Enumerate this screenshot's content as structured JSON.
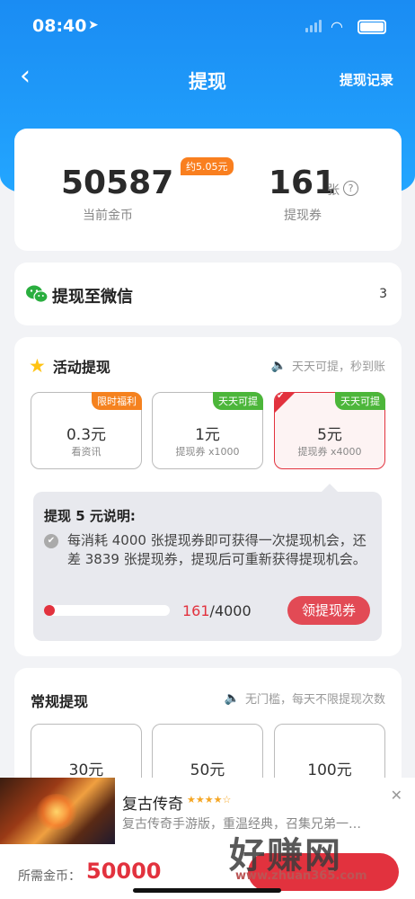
{
  "status": {
    "time": "08:40"
  },
  "nav": {
    "back": "‹",
    "title": "提现",
    "record": "提现记录"
  },
  "balance": {
    "coins": "50587",
    "approx_badge": "约5.05元",
    "coins_label": "当前金币",
    "tickets": "161",
    "tickets_unit": "张",
    "tickets_label": "提现券"
  },
  "wechat": {
    "title": "提现至微信",
    "count": "3"
  },
  "activity": {
    "title": "活动提现",
    "note": "天天可提，秒到账",
    "options": [
      {
        "tag": "限时福利",
        "tag_color": "#f5821f",
        "amount": "0.3元",
        "sub": "看资讯",
        "selected": false
      },
      {
        "tag": "天天可提",
        "tag_color": "#4cb63a",
        "amount": "1元",
        "sub": "提现券 x1000",
        "selected": false
      },
      {
        "tag": "天天可提",
        "tag_color": "#4cb63a",
        "amount": "5元",
        "sub": "提现券 x4000",
        "selected": true
      }
    ],
    "explain": {
      "title": "提现 5 元说明:",
      "text": "每消耗 4000 张提现券即可获得一次提现机会，还差 3839 张提现券，提现后可重新获得提现机会。",
      "progress_current": "161",
      "progress_total": "/4000",
      "progress_fraction": 0.04,
      "button": "领提现券"
    }
  },
  "regular": {
    "title": "常规提现",
    "note": "无门槛，每天不限提现次数",
    "options": [
      {
        "amount": "30元"
      },
      {
        "amount": "50元"
      },
      {
        "amount": "100元"
      }
    ]
  },
  "ad": {
    "name": "复古传奇",
    "stars": "★★★★☆",
    "desc": "复古传奇手游版，重温经典，召集兄弟一…",
    "close": "✕"
  },
  "footer": {
    "need_label": "所需金币：",
    "need_value": "50000",
    "watermark": "好赚网",
    "watermark_url": "www.zhuan365.com"
  }
}
